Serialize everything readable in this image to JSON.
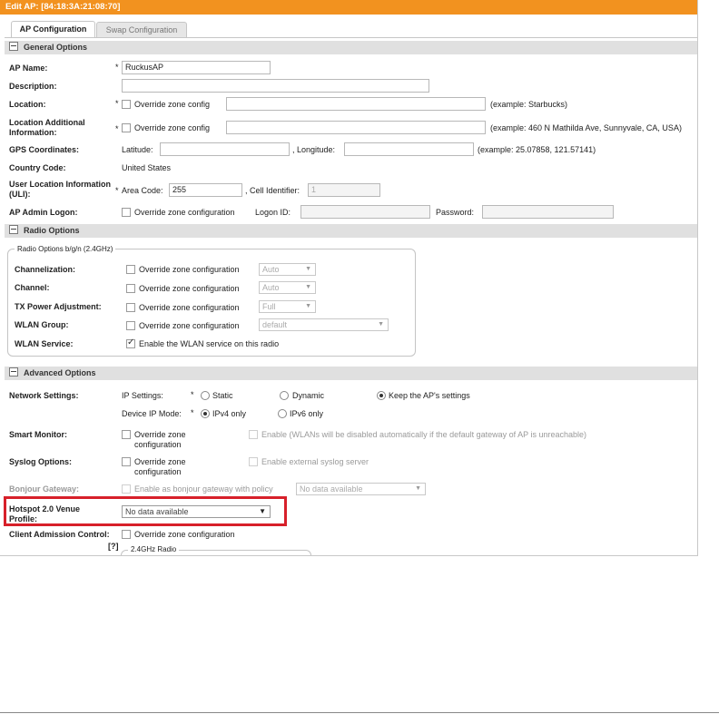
{
  "window": {
    "title": "Edit AP: [84:18:3A:21:08:70]"
  },
  "tabs": [
    {
      "label": "AP Configuration"
    },
    {
      "label": "Swap Configuration"
    }
  ],
  "sections": {
    "general": "General Options",
    "radio": "Radio Options",
    "advanced": "Advanced Options"
  },
  "general": {
    "ap_name_label": "AP Name:",
    "ap_name_value": "RuckusAP",
    "description_label": "Description:",
    "location_label": "Location:",
    "override_zone_config": "Override zone config",
    "location_example": "(example: Starbucks)",
    "location_additional_label": "Location Additional Information:",
    "location_additional_example": "(example: 460 N Mathilda Ave, Sunnyvale, CA, USA)",
    "gps_label": "GPS Coordinates:",
    "latitude_label": "Latitude:",
    "longitude_label": ", Longitude:",
    "gps_example": "(example: 25.07858, 121.57141)",
    "country_label": "Country Code:",
    "country_value": "United States",
    "uli_label": "User Location Information (ULI):",
    "area_code_label": "Area Code:",
    "area_code_value": "255",
    "cell_identifier_label": ", Cell Identifier:",
    "cell_identifier_value": "1",
    "admin_logon_label": "AP Admin Logon:",
    "override_zone_configuration": "Override zone configuration",
    "logon_id_label": "Logon ID:",
    "password_label": "Password:"
  },
  "radio": {
    "group_legend": "Radio Options b/g/n (2.4GHz)",
    "channelization_label": "Channelization:",
    "channel_label": "Channel:",
    "tx_power_label": "TX Power Adjustment:",
    "wlan_group_label": "WLAN Group:",
    "wlan_service_label": "WLAN Service:",
    "override_zone_configuration": "Override zone configuration",
    "channelization_value": "Auto",
    "channel_value": "Auto",
    "tx_power_value": "Full",
    "wlan_group_value": "default",
    "wlan_service_text": "Enable the WLAN service on this radio"
  },
  "advanced": {
    "network_settings_label": "Network Settings:",
    "ip_settings_label": "IP Settings:",
    "static_label": "Static",
    "dynamic_label": "Dynamic",
    "keep_label": "Keep the AP's settings",
    "device_ip_mode_label": "Device IP Mode:",
    "ipv4_label": "IPv4 only",
    "ipv6_label": "IPv6 only",
    "smart_monitor_label": "Smart Monitor:",
    "override_zone_configuration": "Override zone configuration",
    "smart_monitor_enable": "Enable (WLANs will be disabled automatically if the default gateway of AP is unreachable)",
    "syslog_label": "Syslog Options:",
    "syslog_enable": "Enable external syslog server",
    "bonjour_label": "Bonjour Gateway:",
    "bonjour_enable": "Enable as bonjour gateway with policy",
    "bonjour_value": "No data available",
    "hotspot_label": "Hotspot 2.0 Venue Profile:",
    "hotspot_value": "No data available",
    "client_admission_label": "Client Admission Control:",
    "client_admission_help": "[?]",
    "client_admission_override": "Override zone configuration",
    "radio_24_legend": "2.4GHz Radio"
  },
  "required_mark": "*",
  "colors": {
    "titlebar": "#f2921f",
    "highlight": "#d7202a"
  }
}
